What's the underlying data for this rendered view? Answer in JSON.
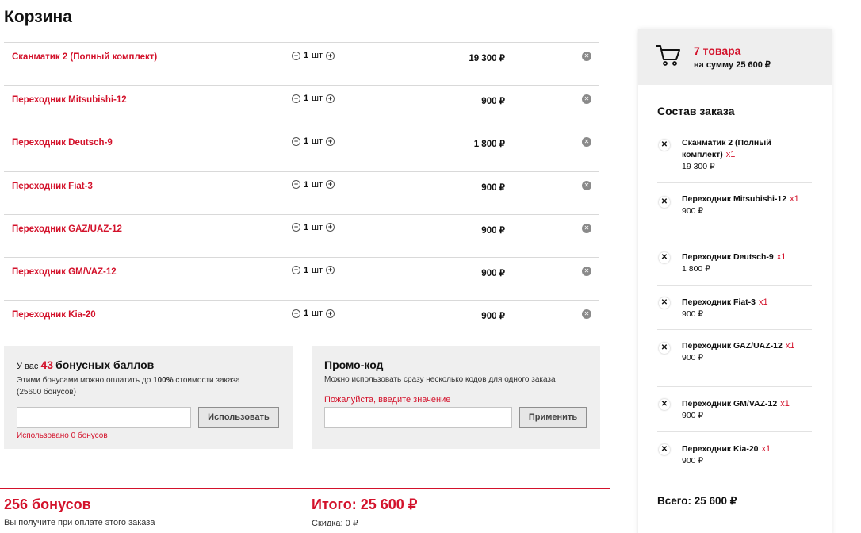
{
  "page": {
    "title": "Корзина"
  },
  "cart": {
    "items": [
      {
        "name": "Сканматик 2 (Полный комплект)",
        "qty": "1",
        "unit": "шт",
        "price": "19 300 ₽"
      },
      {
        "name": "Переходник Mitsubishi-12",
        "qty": "1",
        "unit": "шт",
        "price": "900 ₽"
      },
      {
        "name": "Переходник Deutsch-9",
        "qty": "1",
        "unit": "шт",
        "price": "1 800 ₽"
      },
      {
        "name": "Переходник Fiat-3",
        "qty": "1",
        "unit": "шт",
        "price": "900 ₽"
      },
      {
        "name": "Переходник GAZ/UAZ-12",
        "qty": "1",
        "unit": "шт",
        "price": "900 ₽"
      },
      {
        "name": "Переходник GM/VAZ-12",
        "qty": "1",
        "unit": "шт",
        "price": "900 ₽"
      },
      {
        "name": "Переходник Kia-20",
        "qty": "1",
        "unit": "шт",
        "price": "900 ₽"
      }
    ]
  },
  "bonus": {
    "prefix": "У вас",
    "points": "43",
    "points_label": "бонусных баллов",
    "desc_1": "Этими бонусами можно оплатить до",
    "desc_percent": "100%",
    "desc_2": "стоимости заказа",
    "desc_3": "(25600 бонусов)",
    "input_value": "",
    "button": "Использовать",
    "used_note": "Использовано 0 бонусов"
  },
  "promo": {
    "title": "Промо-код",
    "desc": "Можно использовать сразу несколько кодов для одного заказа",
    "error": "Пожалуйста, введите значение",
    "input_value": "",
    "button": "Применить"
  },
  "summary": {
    "bonus_total": "256 бонусов",
    "bonus_note": "Вы получите при оплате этого заказа",
    "total": "Итого: 25 600 ₽",
    "discount": "Скидка: 0 ₽"
  },
  "sidebar": {
    "count": "7 товара",
    "sum": "на сумму 25 600 ₽",
    "title": "Состав заказа",
    "items": [
      {
        "name": "Сканматик 2 (Полный комплект)",
        "mult": "x1",
        "price": "19 300 ₽"
      },
      {
        "name": "Переходник Mitsubishi-12",
        "mult": "x1",
        "price": "900 ₽"
      },
      {
        "name": "Переходник Deutsch-9",
        "mult": "x1",
        "price": "1 800 ₽"
      },
      {
        "name": "Переходник Fiat-3",
        "mult": "x1",
        "price": "900 ₽"
      },
      {
        "name": "Переходник GAZ/UAZ-12",
        "mult": "x1",
        "price": "900 ₽"
      },
      {
        "name": "Переходник GM/VAZ-12",
        "mult": "x1",
        "price": "900 ₽"
      },
      {
        "name": "Переходник Kia-20",
        "mult": "x1",
        "price": "900 ₽"
      }
    ],
    "total": "Всего: 25 600 ₽"
  },
  "icons": {
    "minus": "minus-icon",
    "plus": "plus-icon",
    "remove": "remove-icon",
    "cart": "cart-icon",
    "close": "close-icon"
  },
  "colors": {
    "accent": "#d3122b",
    "panel": "#efefef"
  }
}
